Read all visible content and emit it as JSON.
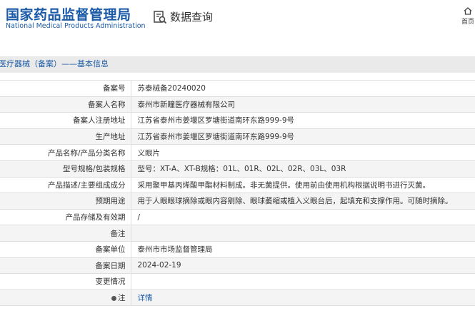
{
  "header": {
    "org_name_cn": "国家药品监督管理局",
    "org_name_en": "National Medical Products Administration",
    "query_label": "数据查询",
    "home_label": "首页"
  },
  "section": {
    "title": "医疗器械（备案）——基本信息"
  },
  "rows": [
    {
      "label": "备案号",
      "value": "苏泰械备20240020"
    },
    {
      "label": "备案人名称",
      "value": "泰州市新瞳医疗器械有限公司"
    },
    {
      "label": "备案人注册地址",
      "value": "江苏省泰州市姜堰区罗塘街道南环东路999-9号"
    },
    {
      "label": "生产地址",
      "value": "江苏省泰州市姜堰区罗塘街道南环东路999-9号"
    },
    {
      "label": "产品名称/产品分类名称",
      "value": "义眼片"
    },
    {
      "label": "型号规格/包装规格",
      "value": "型号：XT-A、XT-B规格：01L、01R、02L、02R、03L、03R"
    },
    {
      "label": "产品描述/主要组成成分",
      "value": "采用聚甲基丙烯酸甲酯材料制成。非无菌提供。使用前由使用机构根据说明书进行灭菌。"
    },
    {
      "label": "预期用途",
      "value": "用于人眼眼球摘除或眼内容剜除、眼球萎缩或植入义眼台后，起填充和支撑作用。可随时摘除。"
    },
    {
      "label": "产品存储及有效期",
      "value": "/"
    },
    {
      "label": "备注",
      "value": ""
    },
    {
      "label": "备案单位",
      "value": "泰州市市场监督管理局"
    },
    {
      "label": "备案日期",
      "value": "2024-02-19"
    },
    {
      "label": "变更情况",
      "value": ""
    },
    {
      "label": "注",
      "value": "详情"
    }
  ],
  "colors": {
    "brand": "#1a5aa6",
    "row_alt": "#f4f4f4",
    "section_bg": "#eaeaea"
  },
  "icons": {
    "query": "search-document-icon",
    "home": "home-icon",
    "note": "tip-icon"
  }
}
